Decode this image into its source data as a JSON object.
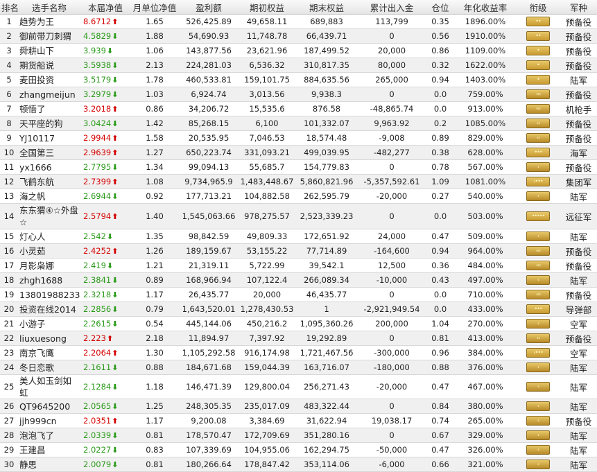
{
  "headers": [
    "排名",
    "选手名称",
    "本届净值",
    "月单位净值",
    "盈利额",
    "期初权益",
    "期末权益",
    "累计出入金",
    "仓位",
    "年化收益率",
    "衔级",
    "军种"
  ],
  "rows": [
    {
      "rank": "1",
      "name": "趋势为王",
      "nav": "8.6712",
      "dir": "up",
      "mnav": "1.65",
      "profit": "526,425.89",
      "start": "49,658.11",
      "end": "689,883",
      "flow": "113,799",
      "pos": "0.35",
      "annual": "1896.00%",
      "rank_icon": "stars-2",
      "branch": "预备役"
    },
    {
      "rank": "2",
      "name": "御前带刀刺猬",
      "nav": "4.5829",
      "dir": "down",
      "mnav": "1.88",
      "profit": "54,690.93",
      "start": "11,748.78",
      "end": "66,439.71",
      "flow": "0",
      "pos": "0.56",
      "annual": "1910.00%",
      "rank_icon": "stars-2",
      "branch": "预备役"
    },
    {
      "rank": "3",
      "name": "舜耕山下",
      "nav": "3.939",
      "dir": "down",
      "mnav": "1.06",
      "profit": "143,877.56",
      "start": "23,621.96",
      "end": "187,499.52",
      "flow": "20,000",
      "pos": "0.86",
      "annual": "1109.00%",
      "rank_icon": "stars-1",
      "branch": "预备役"
    },
    {
      "rank": "4",
      "name": "期货船说",
      "nav": "3.5938",
      "dir": "down",
      "mnav": "2.13",
      "profit": "224,281.03",
      "start": "6,536.32",
      "end": "310,817.35",
      "flow": "80,000",
      "pos": "0.32",
      "annual": "1622.00%",
      "rank_icon": "stars-1",
      "branch": "预备役"
    },
    {
      "rank": "5",
      "name": "麦田投资",
      "nav": "3.5179",
      "dir": "down",
      "mnav": "1.78",
      "profit": "460,533.81",
      "start": "159,101.75",
      "end": "884,635.56",
      "flow": "265,000",
      "pos": "0.94",
      "annual": "1403.00%",
      "rank_icon": "stars-1",
      "branch": "陆军"
    },
    {
      "rank": "6",
      "name": "zhangmeijun",
      "nav": "3.2979",
      "dir": "down",
      "mnav": "1.03",
      "profit": "6,924.74",
      "start": "3,013.56",
      "end": "9,938.3",
      "flow": "0",
      "pos": "0.0",
      "annual": "759.00%",
      "rank_icon": "chev-3",
      "branch": "预备役"
    },
    {
      "rank": "7",
      "name": "顿悟了",
      "nav": "3.2018",
      "dir": "up",
      "mnav": "0.86",
      "profit": "34,206.72",
      "start": "15,535.6",
      "end": "876.58",
      "flow": "-48,865.74",
      "pos": "0.0",
      "annual": "913.00%",
      "rank_icon": "chev-3",
      "branch": "机枪手"
    },
    {
      "rank": "8",
      "name": "天平座的狗",
      "nav": "3.0424",
      "dir": "down",
      "mnav": "1.42",
      "profit": "85,268.15",
      "start": "6,100",
      "end": "101,332.07",
      "flow": "9,963.92",
      "pos": "0.2",
      "annual": "1085.00%",
      "rank_icon": "chev-2",
      "branch": "预备役"
    },
    {
      "rank": "9",
      "name": "YJ10117",
      "nav": "2.9944",
      "dir": "up",
      "mnav": "1.58",
      "profit": "20,535.95",
      "start": "7,046.53",
      "end": "18,574.48",
      "flow": "-9,008",
      "pos": "0.89",
      "annual": "829.00%",
      "rank_icon": "chev-2",
      "branch": "预备役"
    },
    {
      "rank": "10",
      "name": "全国第三",
      "nav": "2.9639",
      "dir": "up",
      "mnav": "1.27",
      "profit": "650,223.74",
      "start": "331,093.21",
      "end": "499,039.95",
      "flow": "-482,277",
      "pos": "0.38",
      "annual": "628.00%",
      "rank_icon": "stars-3",
      "branch": "海军"
    },
    {
      "rank": "11",
      "name": "yx1666",
      "nav": "2.7795",
      "dir": "down",
      "mnav": "1.34",
      "profit": "99,094.13",
      "start": "55,685.7",
      "end": "154,779.83",
      "flow": "0",
      "pos": "0.78",
      "annual": "567.00%",
      "rank_icon": "chev-1",
      "branch": "预备役"
    },
    {
      "rank": "12",
      "name": "飞鹤东航",
      "nav": "2.7399",
      "dir": "up",
      "mnav": "1.08",
      "profit": "9,734,965.9",
      "start": "1,483,448.67",
      "end": "5,860,821.96",
      "flow": "-5,357,592.61",
      "pos": "1.09",
      "annual": "1081.00%",
      "rank_icon": "stars-3c",
      "branch": "集团军"
    },
    {
      "rank": "13",
      "name": "海之帆",
      "nav": "2.6944",
      "dir": "down",
      "mnav": "0.92",
      "profit": "177,713.21",
      "start": "104,882.58",
      "end": "262,595.79",
      "flow": "-20,000",
      "pos": "0.27",
      "annual": "540.00%",
      "rank_icon": "chev-1",
      "branch": "陆军"
    },
    {
      "rank": "14",
      "name": "东东猬④☆外盘☆",
      "nav": "2.5794",
      "dir": "up",
      "mnav": "1.40",
      "profit": "1,545,063.66",
      "start": "978,275.57",
      "end": "2,523,339.23",
      "flow": "0",
      "pos": "0.0",
      "annual": "503.00%",
      "rank_icon": "stars-5",
      "branch": "远征军"
    },
    {
      "rank": "15",
      "name": "灯心人",
      "nav": "2.542",
      "dir": "down",
      "mnav": "1.35",
      "profit": "98,842.59",
      "start": "49,809.33",
      "end": "172,651.92",
      "flow": "24,000",
      "pos": "0.47",
      "annual": "509.00%",
      "rank_icon": "chev-1",
      "branch": "陆军"
    },
    {
      "rank": "16",
      "name": "小灵茹",
      "nav": "2.4252",
      "dir": "up",
      "mnav": "1.26",
      "profit": "189,159.67",
      "start": "53,155.22",
      "end": "77,714.89",
      "flow": "-164,600",
      "pos": "0.94",
      "annual": "964.00%",
      "rank_icon": "chev-3",
      "branch": "预备役"
    },
    {
      "rank": "17",
      "name": "月影枭娜",
      "nav": "2.419",
      "dir": "down",
      "mnav": "1.21",
      "profit": "21,319.11",
      "start": "5,722.99",
      "end": "39,542.1",
      "flow": "12,500",
      "pos": "0.36",
      "annual": "484.00%",
      "rank_icon": "chev-3",
      "branch": "预备役"
    },
    {
      "rank": "18",
      "name": "zhgh1688",
      "nav": "2.3841",
      "dir": "down",
      "mnav": "0.89",
      "profit": "168,966.94",
      "start": "107,122.4",
      "end": "266,089.34",
      "flow": "-10,000",
      "pos": "0.43",
      "annual": "497.00%",
      "rank_icon": "chev-1",
      "branch": "陆军"
    },
    {
      "rank": "19",
      "name": "13801988233",
      "nav": "2.3218",
      "dir": "down",
      "mnav": "1.17",
      "profit": "26,435.77",
      "start": "20,000",
      "end": "46,435.77",
      "flow": "0",
      "pos": "0.0",
      "annual": "710.00%",
      "rank_icon": "chev-3",
      "branch": "预备役"
    },
    {
      "rank": "20",
      "name": "投资在线2014",
      "nav": "2.2856",
      "dir": "down",
      "mnav": "0.79",
      "profit": "1,643,520.01",
      "start": "1,278,430.53",
      "end": "1",
      "flow": "-2,921,949.54",
      "pos": "0.0",
      "annual": "433.00%",
      "rank_icon": "stars-3",
      "branch": "导弹部"
    },
    {
      "rank": "21",
      "name": "小游子",
      "nav": "2.2615",
      "dir": "down",
      "mnav": "0.54",
      "profit": "445,144.06",
      "start": "450,216.2",
      "end": "1,095,360.26",
      "flow": "200,000",
      "pos": "1.04",
      "annual": "270.00%",
      "rank_icon": "chev-1",
      "branch": "空军"
    },
    {
      "rank": "22",
      "name": "liuxuesong",
      "nav": "2.223",
      "dir": "up",
      "mnav": "2.18",
      "profit": "11,894.97",
      "start": "7,397.92",
      "end": "19,292.89",
      "flow": "0",
      "pos": "0.81",
      "annual": "413.00%",
      "rank_icon": "chev-2",
      "branch": "预备役"
    },
    {
      "rank": "23",
      "name": "南京飞鹰",
      "nav": "2.2064",
      "dir": "up",
      "mnav": "1.30",
      "profit": "1,105,292.58",
      "start": "916,174.98",
      "end": "1,721,467.56",
      "flow": "-300,000",
      "pos": "0.96",
      "annual": "384.00%",
      "rank_icon": "stars-3c",
      "branch": "空军"
    },
    {
      "rank": "24",
      "name": "冬日恋歌",
      "nav": "2.1611",
      "dir": "down",
      "mnav": "0.88",
      "profit": "184,671.68",
      "start": "159,044.39",
      "end": "163,716.07",
      "flow": "-180,000",
      "pos": "0.88",
      "annual": "376.00%",
      "rank_icon": "chev-1",
      "branch": "陆军"
    },
    {
      "rank": "25",
      "name": "美人如玉剑如虹",
      "nav": "2.1284",
      "dir": "down",
      "mnav": "1.18",
      "profit": "146,471.39",
      "start": "129,800.04",
      "end": "256,271.43",
      "flow": "-20,000",
      "pos": "0.47",
      "annual": "467.00%",
      "rank_icon": "chev-1",
      "branch": "陆军"
    },
    {
      "rank": "26",
      "name": "QT9645200",
      "nav": "2.0565",
      "dir": "down",
      "mnav": "1.25",
      "profit": "248,305.35",
      "start": "235,017.09",
      "end": "483,322.44",
      "flow": "0",
      "pos": "0.84",
      "annual": "380.00%",
      "rank_icon": "chev-1",
      "branch": "陆军"
    },
    {
      "rank": "27",
      "name": "jjh999cn",
      "nav": "2.0351",
      "dir": "up",
      "mnav": "1.17",
      "profit": "9,200.08",
      "start": "3,384.69",
      "end": "31,622.94",
      "flow": "19,038.17",
      "pos": "0.74",
      "annual": "265.00%",
      "rank_icon": "chev-1",
      "branch": "预备役"
    },
    {
      "rank": "28",
      "name": "泡泡飞了",
      "nav": "2.0339",
      "dir": "down",
      "mnav": "0.81",
      "profit": "178,570.47",
      "start": "172,709.69",
      "end": "351,280.16",
      "flow": "0",
      "pos": "0.67",
      "annual": "329.00%",
      "rank_icon": "chev-1",
      "branch": "陆军"
    },
    {
      "rank": "29",
      "name": "王建昌",
      "nav": "2.0227",
      "dir": "down",
      "mnav": "0.83",
      "profit": "107,339.69",
      "start": "104,955.06",
      "end": "162,294.75",
      "flow": "-50,000",
      "pos": "0.47",
      "annual": "326.00%",
      "rank_icon": "chev-1",
      "branch": "陆军"
    },
    {
      "rank": "30",
      "name": "静思",
      "nav": "2.0079",
      "dir": "down",
      "mnav": "0.81",
      "profit": "180,266.64",
      "start": "178,847.42",
      "end": "353,114.06",
      "flow": "-6,000",
      "pos": "0.66",
      "annual": "321.00%",
      "rank_icon": "chev-1",
      "branch": "陆军"
    }
  ],
  "colors": {
    "up": "#d40000",
    "down": "#2a9a1a"
  }
}
